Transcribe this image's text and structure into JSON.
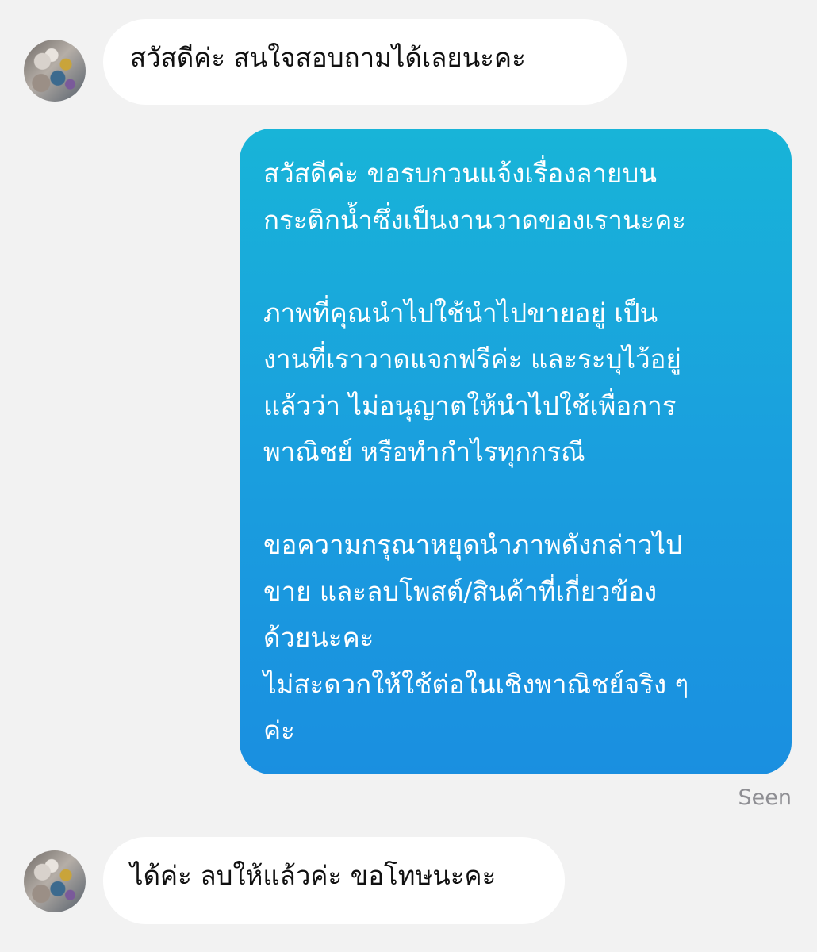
{
  "conversation": {
    "incoming_1": {
      "avatar": "user-avatar",
      "text": "สวัสดีค่ะ สนใจสอบถามได้เลยนะคะ"
    },
    "outgoing": {
      "paragraphs": [
        "สวัสดีค่ะ ขอรบกวนแจ้งเรื่องลายบน\nกระติกน้ำซึ่งเป็นงานวาดของเรานะคะ",
        "ภาพที่คุณนำไปใช้นำไปขายอยู่ เป็น\nงานที่เราวาดแจกฟรีค่ะ และระบุไว้อยู่\nแล้วว่า ไม่อนุญาตให้นำไปใช้เพื่อการ\nพาณิชย์ หรือทำกำไรทุกกรณี",
        "ขอความกรุณาหยุดนำภาพดังกล่าวไป\nขาย และลบโพสต์/สินค้าที่เกี่ยวข้อง\nด้วยนะคะ\nไม่สะดวกให้ใช้ต่อในเชิงพาณิชย์จริง ๆ\nค่ะ"
      ],
      "status": "Seen"
    },
    "incoming_2": {
      "avatar": "user-avatar",
      "text": "ได้ค่ะ ลบให้แล้วค่ะ ขอโทษนะคะ"
    }
  },
  "colors": {
    "background": "#f2f2f2",
    "incoming_bubble": "#ffffff",
    "outgoing_gradient_top": "#18b4d8",
    "outgoing_gradient_bottom": "#1a8fe0",
    "seen_text": "#8e8e93"
  }
}
